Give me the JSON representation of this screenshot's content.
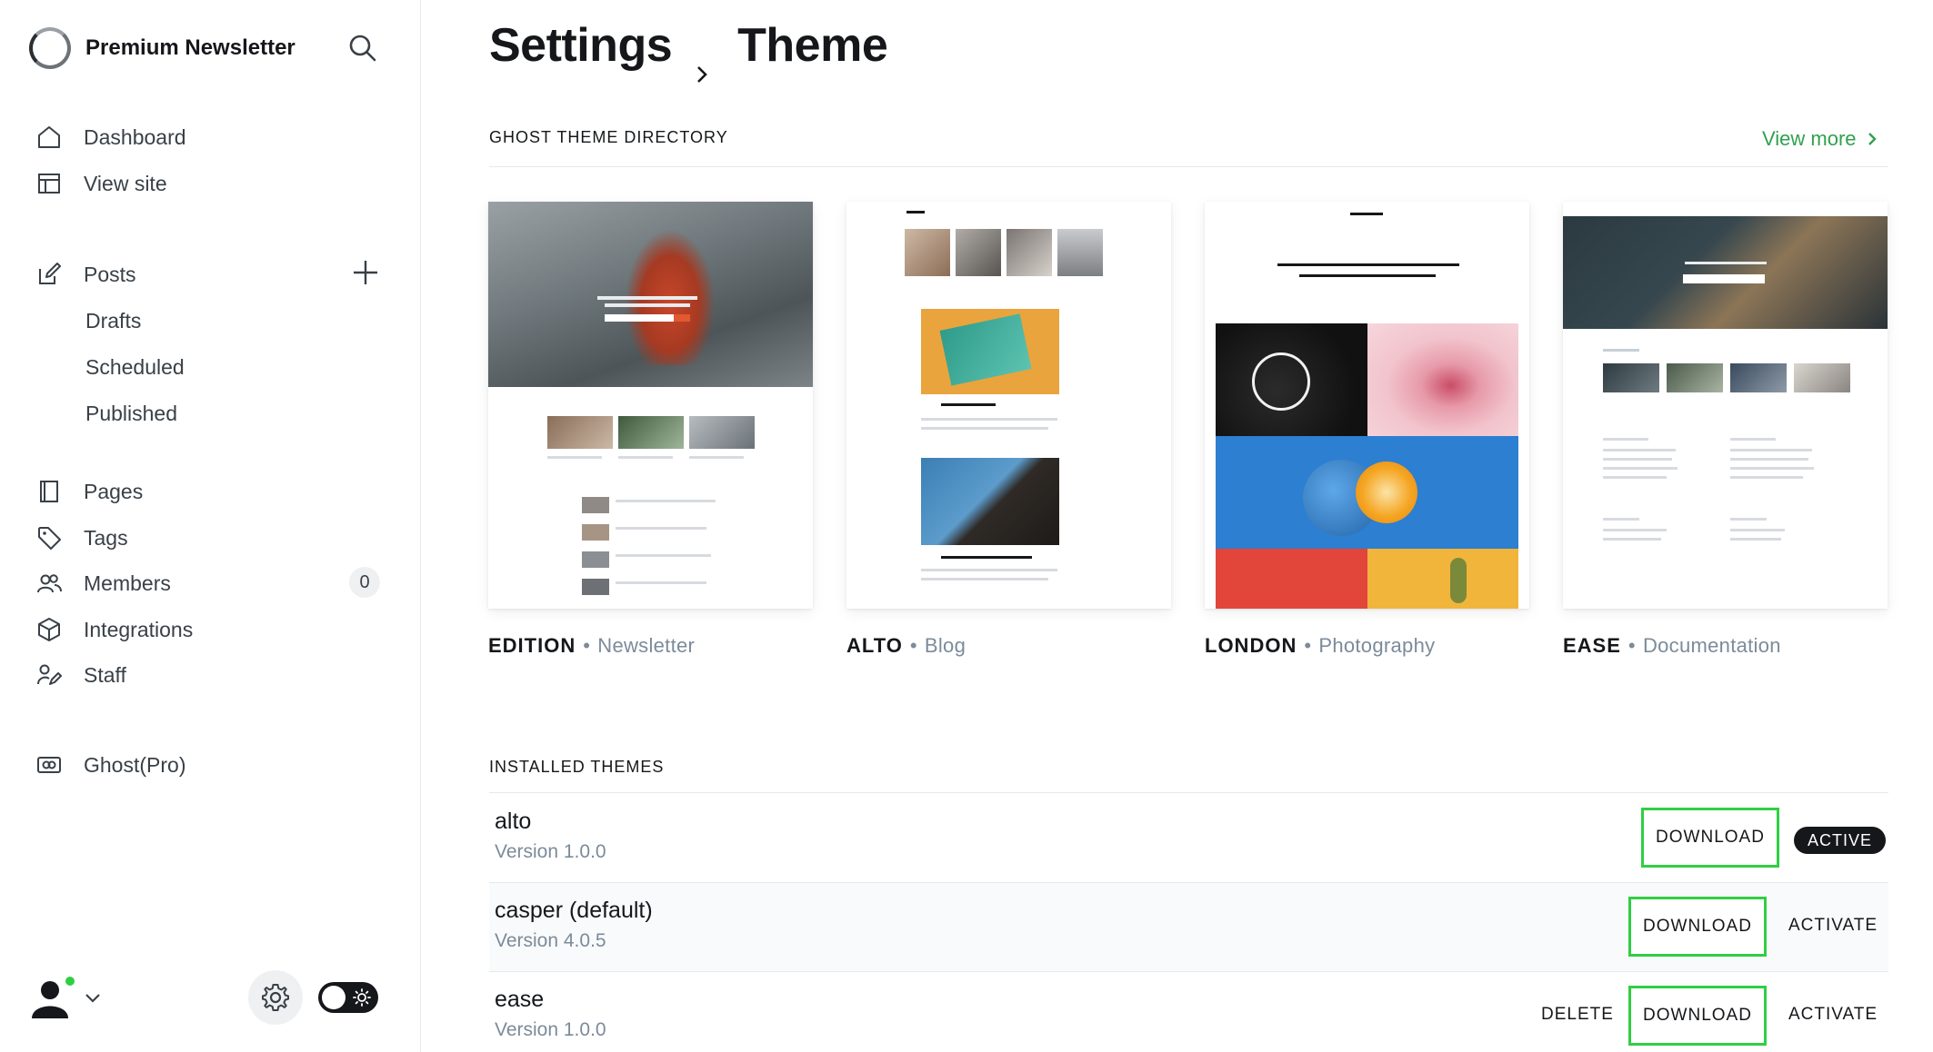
{
  "sidebar": {
    "brand": "Premium Newsletter",
    "nav_primary": [
      {
        "label": "Dashboard",
        "icon": "home-icon"
      },
      {
        "label": "View site",
        "icon": "layout-icon"
      }
    ],
    "posts": {
      "label": "Posts",
      "icon": "edit-icon",
      "sub": [
        "Drafts",
        "Scheduled",
        "Published"
      ]
    },
    "nav_secondary": [
      {
        "label": "Pages",
        "icon": "page-icon"
      },
      {
        "label": "Tags",
        "icon": "tag-icon"
      },
      {
        "label": "Members",
        "icon": "members-icon",
        "count": "0"
      },
      {
        "label": "Integrations",
        "icon": "box-icon"
      },
      {
        "label": "Staff",
        "icon": "staff-icon"
      }
    ],
    "ghost_pro": {
      "label": "Ghost(Pro)",
      "icon": "ghost-pro-icon"
    }
  },
  "header": {
    "breadcrumb_parent": "Settings",
    "breadcrumb_current": "Theme"
  },
  "directory": {
    "heading": "GHOST THEME DIRECTORY",
    "view_more": "View more",
    "themes": [
      {
        "name": "EDITION",
        "category": "Newsletter"
      },
      {
        "name": "ALTO",
        "category": "Blog"
      },
      {
        "name": "LONDON",
        "category": "Photography"
      },
      {
        "name": "EASE",
        "category": "Documentation"
      }
    ],
    "separator": "•"
  },
  "installed": {
    "heading": "INSTALLED THEMES",
    "download_label": "DOWNLOAD",
    "activate_label": "ACTIVATE",
    "delete_label": "DELETE",
    "active_label": "ACTIVE",
    "rows": [
      {
        "name": "alto",
        "version": "Version 1.0.0",
        "active": true
      },
      {
        "name": "casper (default)",
        "version": "Version 4.0.5",
        "active": false
      },
      {
        "name": "ease",
        "version": "Version 1.0.0",
        "active": false
      }
    ]
  },
  "colors": {
    "accent_green": "#30cf43",
    "link_green": "#30a14e",
    "text_dark": "#15171a",
    "text_muted": "#7c8b9a"
  }
}
